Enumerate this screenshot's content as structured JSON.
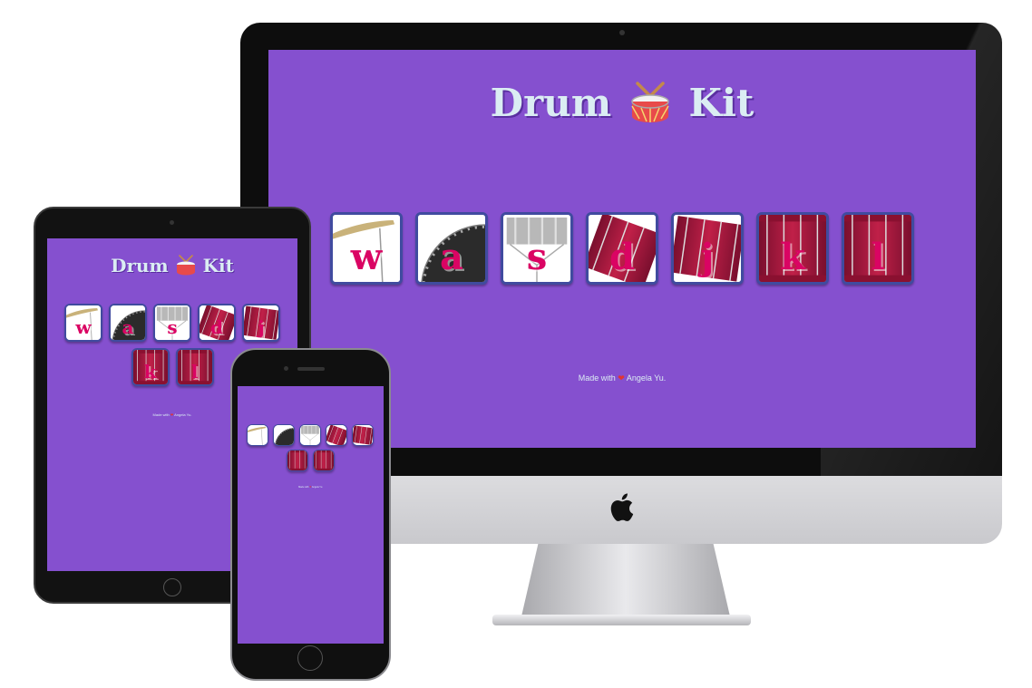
{
  "site": {
    "title_left": "Drum",
    "title_right": "Kit",
    "footer_prefix": "Made with",
    "footer_suffix": "Angela Yu.",
    "heart": "❤"
  },
  "pads": [
    {
      "key": "w",
      "art": "crash-cymbal"
    },
    {
      "key": "a",
      "art": "kick-drum"
    },
    {
      "key": "s",
      "art": "snare-drum"
    },
    {
      "key": "d",
      "art": "tom-1"
    },
    {
      "key": "j",
      "art": "tom-2"
    },
    {
      "key": "k",
      "art": "tom-3"
    },
    {
      "key": "l",
      "art": "tom-4"
    }
  ],
  "colors": {
    "background": "#8550cf",
    "title": "#dbedf3",
    "key_letter": "#da0463",
    "pad_border": "#404b9f"
  }
}
